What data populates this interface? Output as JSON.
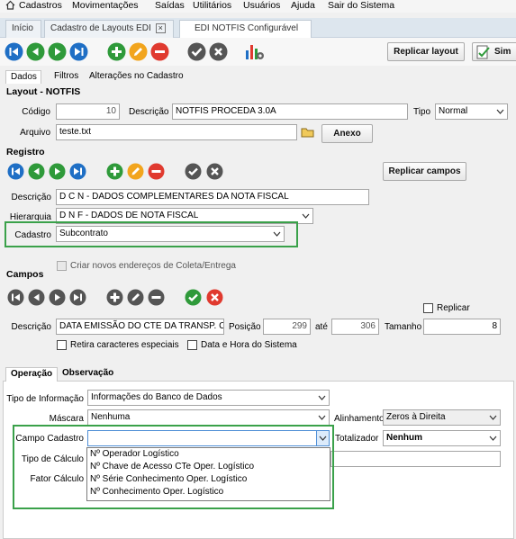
{
  "menubar": {
    "items": [
      "Cadastros",
      "Movimentações",
      "Saídas",
      "Utilitários",
      "Usuários",
      "Ajuda",
      "Sair do Sistema"
    ]
  },
  "doc_tabs": [
    {
      "label": "Início"
    },
    {
      "label": "Cadastro de Layouts EDI"
    },
    {
      "label": "EDI NOTFIS Configurável"
    }
  ],
  "toolbar": {
    "replicar_layout": "Replicar layout",
    "sim": "Sim"
  },
  "main_tabs": [
    "Dados",
    "Filtros",
    "Alterações no Cadastro"
  ],
  "layout": {
    "section": "Layout - NOTFIS",
    "codigo_label": "Código",
    "codigo": "10",
    "descricao_label": "Descrição",
    "descricao": "NOTFIS PROCEDA 3.0A",
    "tipo_label": "Tipo",
    "tipo": "Normal",
    "arquivo_label": "Arquivo",
    "arquivo": "teste.txt",
    "anexo": "Anexo"
  },
  "registro": {
    "section": "Registro",
    "replicar_campos": "Replicar campos",
    "descricao_label": "Descrição",
    "descricao": "D C N - DADOS COMPLEMENTARES DA NOTA FISCAL",
    "hierarquia_label": "Hierarquia",
    "hierarquia": "D N F  - DADOS DE NOTA FISCAL",
    "cadastro_label": "Cadastro",
    "cadastro": "Subcontrato",
    "criar_enderecos": "Criar novos endereços de Coleta/Entrega"
  },
  "campos": {
    "section": "Campos",
    "replicar_label": "Replicar",
    "descricao_label": "Descrição",
    "descricao": "DATA EMISSÃO DO CTE DA TRANSP. CON",
    "posicao_label": "Posição",
    "posicao": "299",
    "ate_label": "até",
    "ate": "306",
    "tamanho_label": "Tamanho",
    "tamanho": "8",
    "retira_label": "Retira caracteres especiais",
    "data_hora_label": "Data e Hora do Sistema"
  },
  "sub_tabs": [
    "Operação",
    "Observação"
  ],
  "operacao": {
    "tipo_info_label": "Tipo de Informação",
    "tipo_info": "Informações do Banco de Dados",
    "mascara_label": "Máscara",
    "mascara": "Nenhuma",
    "alinhamento_label": "Alinhamento",
    "alinhamento": "Zeros à Direita",
    "campo_cadastro_label": "Campo Cadastro",
    "campo_cadastro": "",
    "totalizador_label": "Totalizador",
    "totalizador": "Nenhum",
    "tipo_calculo_label": "Tipo de Cálculo",
    "fator_calculo_label": "Fator Cálculo",
    "dropdown_options": [
      "Nº Operador Logístico",
      "Nº Chave de Acesso CTe Oper. Logístico",
      "Nº Série Conhecimento Oper. Logístico",
      "Nº Conhecimento Oper. Logístico"
    ]
  },
  "colors": {
    "nav_blue": "#1f6fc5",
    "add_green": "#2f9a3a",
    "edit_orange": "#f2a51d",
    "delete_red": "#e03a2f",
    "confirm_grey": "#555555",
    "highlight_green": "#3aa14a"
  }
}
